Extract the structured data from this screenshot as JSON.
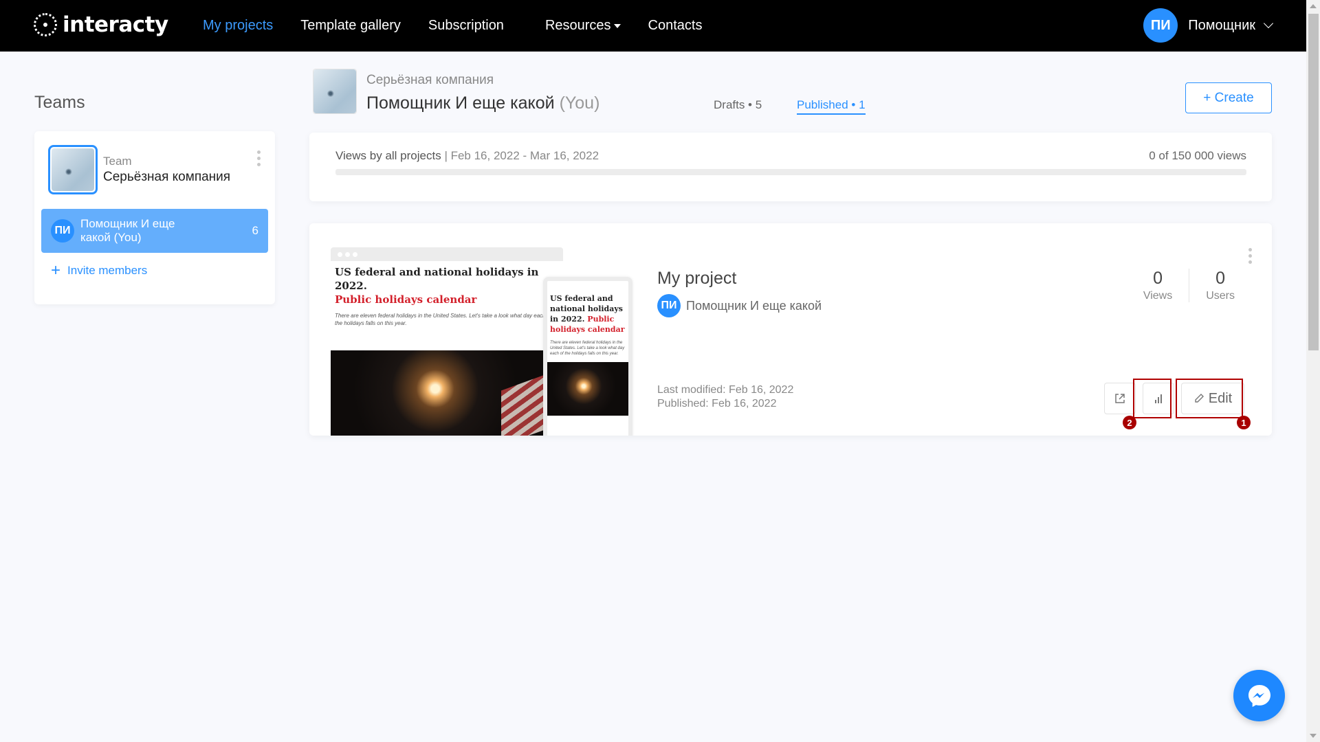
{
  "app": {
    "logo_text": "interacty"
  },
  "nav": {
    "items": [
      {
        "label": "My projects",
        "active": true
      },
      {
        "label": "Template gallery"
      },
      {
        "label": "Subscription"
      },
      {
        "label": "Resources"
      },
      {
        "label": "Contacts"
      }
    ]
  },
  "user": {
    "initials": "ПИ",
    "name": "Помощник"
  },
  "sidebar": {
    "title": "Teams",
    "team": {
      "label": "Team",
      "name": "Серьёзная компания"
    },
    "member": {
      "initials": "ПИ",
      "name": "Помощник И еще какой (You)",
      "count": "6"
    },
    "invite_label": "Invite members"
  },
  "header": {
    "org": "Серьёзная компания",
    "name": "Помощник И еще какой",
    "you_suffix": "(You)",
    "tabs": [
      {
        "label": "Drafts • 5",
        "active": false
      },
      {
        "label": "Published  • 1",
        "active": true
      }
    ],
    "create_label": "+ Create"
  },
  "views": {
    "label": "Views by all projects",
    "range": "| Feb 16, 2022 - Mar 16, 2022",
    "count": "0 of 150 000 views",
    "progress_fraction": 0
  },
  "project": {
    "title": "My project",
    "owner_initials": "ПИ",
    "owner_name": "Помощник И еще какой",
    "stats": [
      {
        "value": "0",
        "label": "Views"
      },
      {
        "value": "0",
        "label": "Users"
      }
    ],
    "last_modified": "Last modified: Feb 16, 2022",
    "published": "Published: Feb 16, 2022",
    "edit_label": "Edit",
    "preview": {
      "title": "US federal and national holidays in 2022.",
      "subtitle": "Public holidays calendar",
      "text": "There are eleven federal holidays in the United States. Let's take a look what day each of the holidays falls on this year.",
      "mobile_title": "US federal and national holidays in 2022.",
      "mobile_subtitle": "Public holidays calendar",
      "mobile_text": "There are eleven federal holidays in the United States. Let's take a look what day each of the holidays falls on this year."
    }
  },
  "annotations": [
    {
      "number": "1",
      "target": "edit-button"
    },
    {
      "number": "2",
      "target": "statistics-button"
    }
  ],
  "colors": {
    "accent": "#2990ff",
    "active_nav": "#3c9bff",
    "member_row": "#64aefc",
    "highlight": "#b00000"
  }
}
